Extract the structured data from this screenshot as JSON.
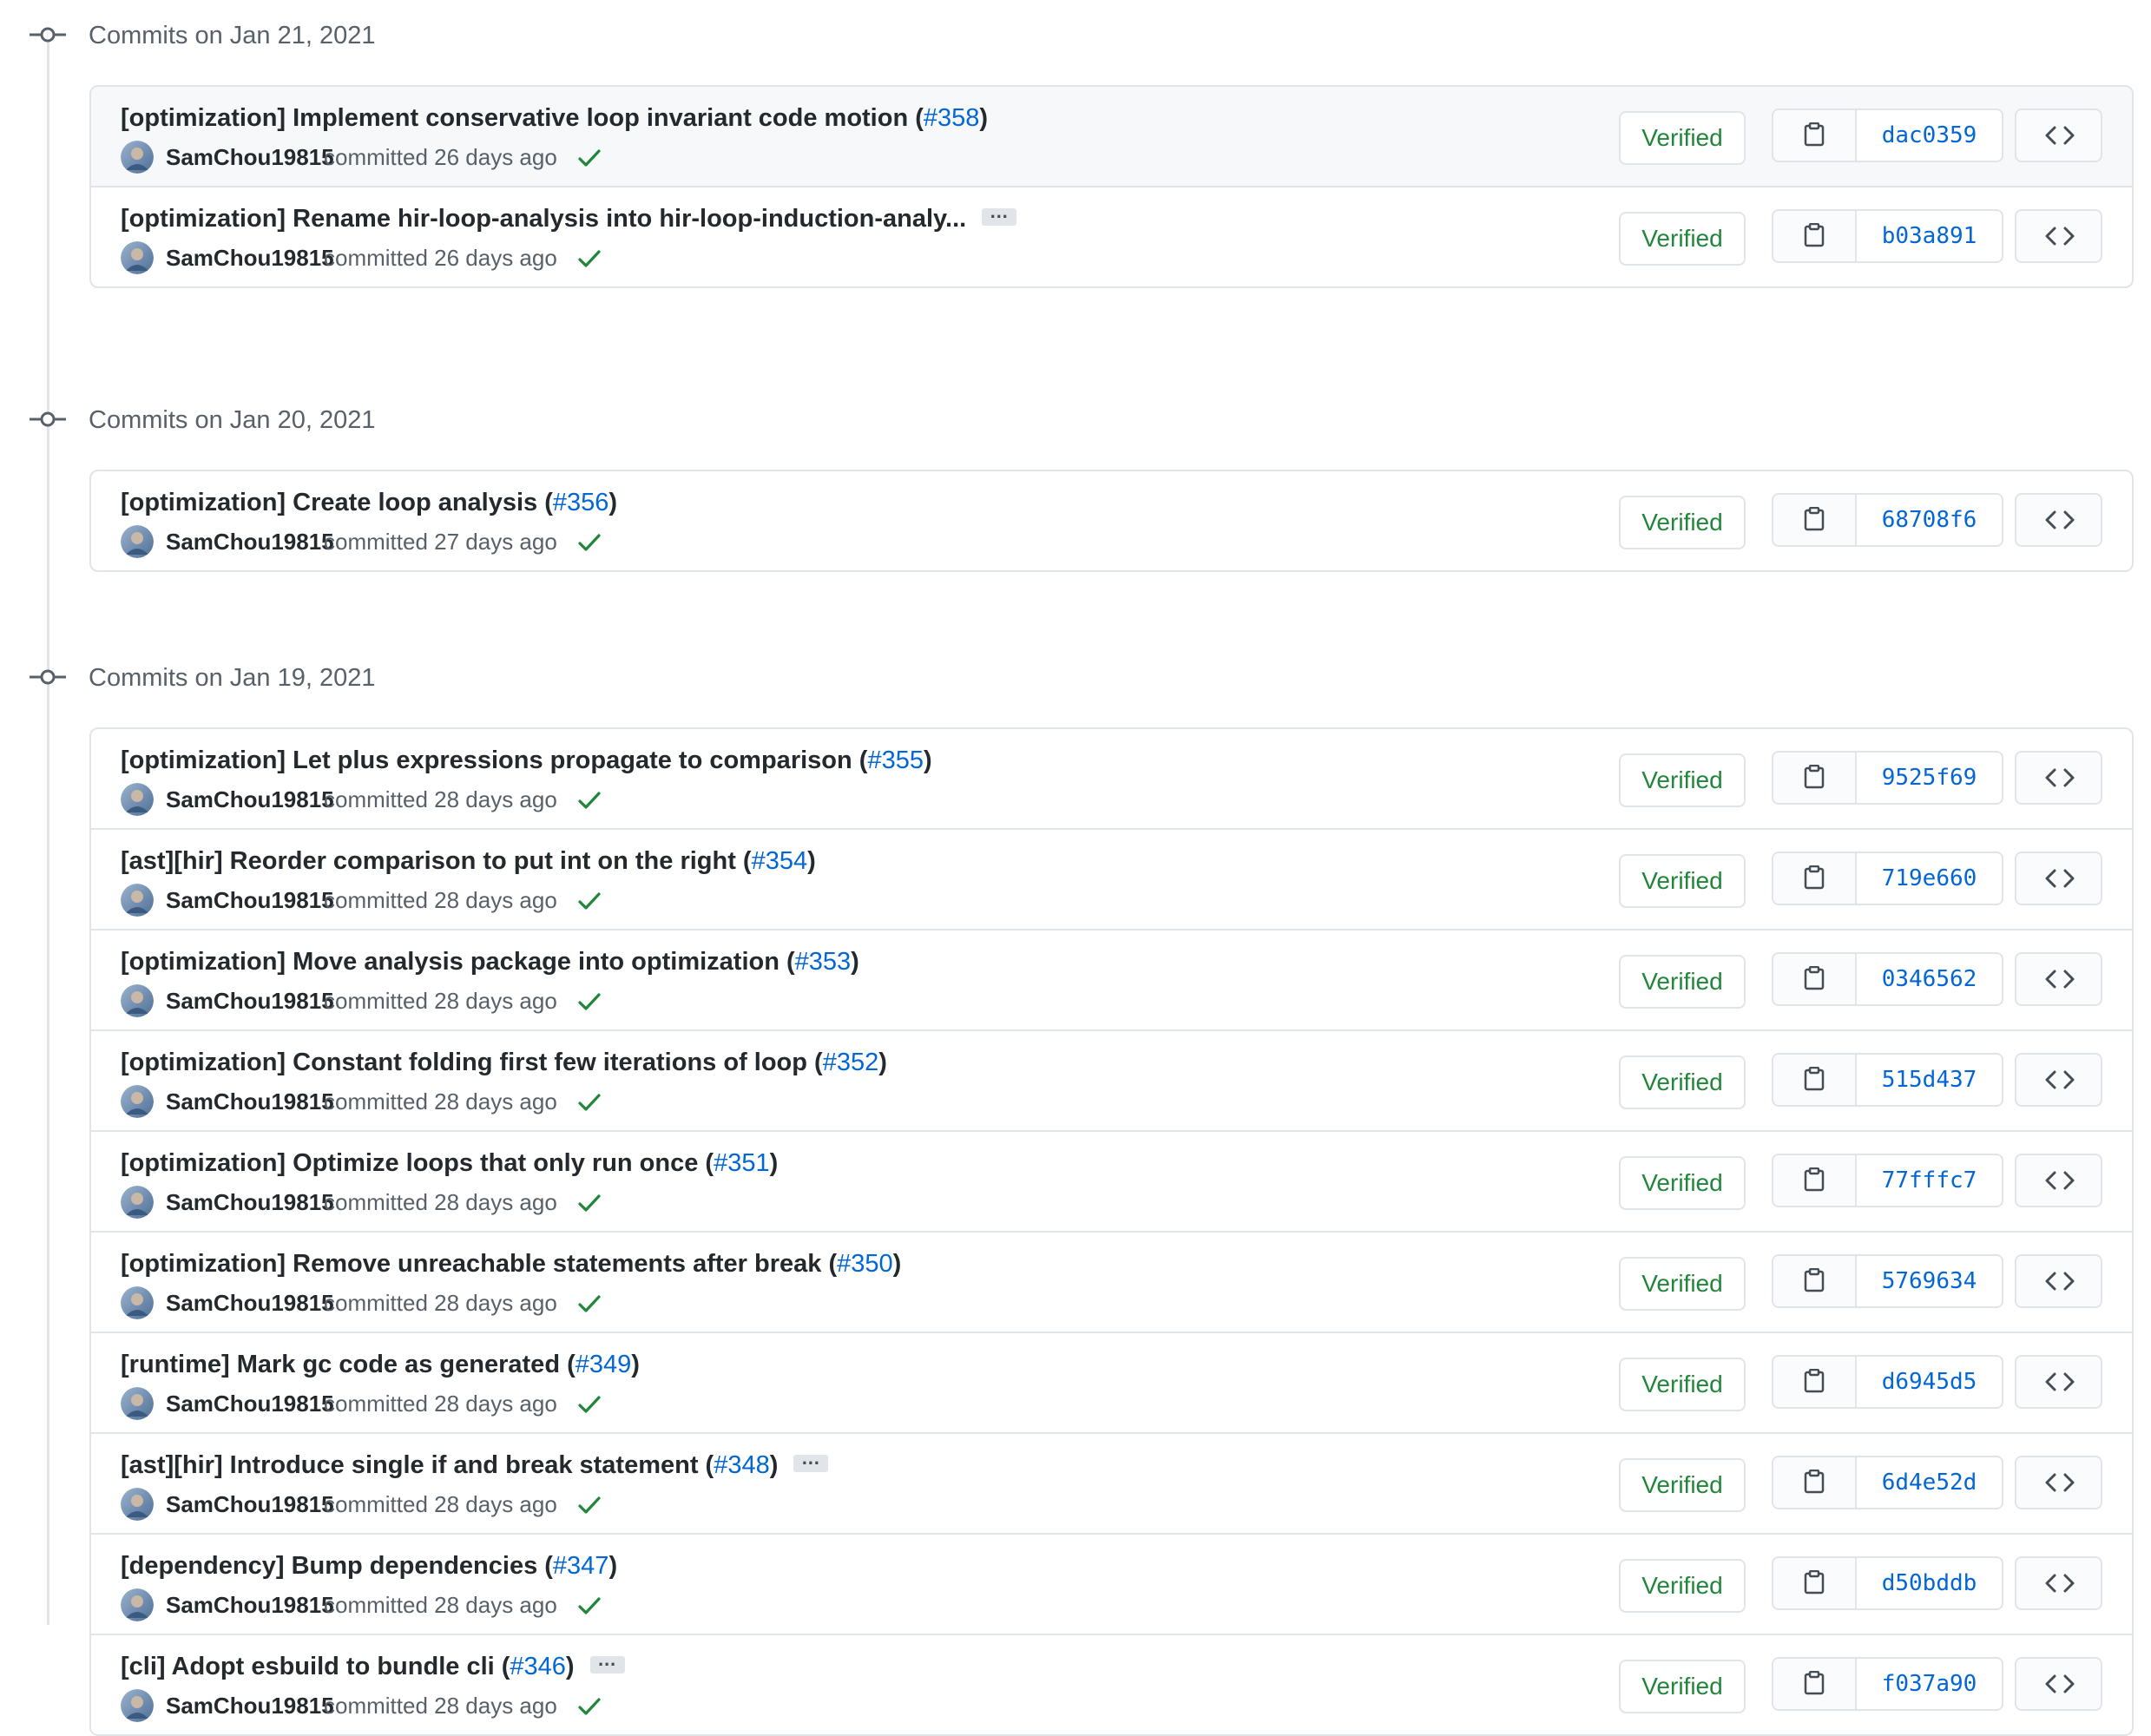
{
  "colors": {
    "link": "#0366d6",
    "verified": "#22863a",
    "border": "#e1e4e8",
    "muted": "#586069"
  },
  "groups": [
    {
      "title": "Commits on Jan 21, 2021",
      "commits": [
        {
          "title": "[optimization] Implement conservative loop invariant code motion",
          "pr": "#358",
          "author": "SamChou19815",
          "meta": "committed 26 days ago",
          "verified": "Verified",
          "sha": "dac0359",
          "ellipsis": false,
          "truncated": false
        },
        {
          "title": "[optimization] Rename hir-loop-analysis into hir-loop-induction-analy...",
          "pr": "",
          "author": "SamChou19815",
          "meta": "committed 26 days ago",
          "verified": "Verified",
          "sha": "b03a891",
          "ellipsis": true,
          "truncated": true
        }
      ]
    },
    {
      "title": "Commits on Jan 20, 2021",
      "commits": [
        {
          "title": "[optimization] Create loop analysis",
          "pr": "#356",
          "author": "SamChou19815",
          "meta": "committed 27 days ago",
          "verified": "Verified",
          "sha": "68708f6",
          "ellipsis": false,
          "truncated": false
        }
      ]
    },
    {
      "title": "Commits on Jan 19, 2021",
      "commits": [
        {
          "title": "[optimization] Let plus expressions propagate to comparison",
          "pr": "#355",
          "author": "SamChou19815",
          "meta": "committed 28 days ago",
          "verified": "Verified",
          "sha": "9525f69",
          "ellipsis": false,
          "truncated": false
        },
        {
          "title": "[ast][hir] Reorder comparison to put int on the right",
          "pr": "#354",
          "author": "SamChou19815",
          "meta": "committed 28 days ago",
          "verified": "Verified",
          "sha": "719e660",
          "ellipsis": false,
          "truncated": false
        },
        {
          "title": "[optimization] Move analysis package into optimization",
          "pr": "#353",
          "author": "SamChou19815",
          "meta": "committed 28 days ago",
          "verified": "Verified",
          "sha": "0346562",
          "ellipsis": false,
          "truncated": false
        },
        {
          "title": "[optimization] Constant folding first few iterations of loop",
          "pr": "#352",
          "author": "SamChou19815",
          "meta": "committed 28 days ago",
          "verified": "Verified",
          "sha": "515d437",
          "ellipsis": false,
          "truncated": false
        },
        {
          "title": "[optimization] Optimize loops that only run once",
          "pr": "#351",
          "author": "SamChou19815",
          "meta": "committed 28 days ago",
          "verified": "Verified",
          "sha": "77fffc7",
          "ellipsis": false,
          "truncated": false
        },
        {
          "title": "[optimization] Remove unreachable statements after break",
          "pr": "#350",
          "author": "SamChou19815",
          "meta": "committed 28 days ago",
          "verified": "Verified",
          "sha": "5769634",
          "ellipsis": false,
          "truncated": false
        },
        {
          "title": "[runtime] Mark gc code as generated",
          "pr": "#349",
          "author": "SamChou19815",
          "meta": "committed 28 days ago",
          "verified": "Verified",
          "sha": "d6945d5",
          "ellipsis": false,
          "truncated": false
        },
        {
          "title": "[ast][hir] Introduce single if and break statement",
          "pr": "#348",
          "author": "SamChou19815",
          "meta": "committed 28 days ago",
          "verified": "Verified",
          "sha": "6d4e52d",
          "ellipsis": true,
          "truncated": false
        },
        {
          "title": "[dependency] Bump dependencies",
          "pr": "#347",
          "author": "SamChou19815",
          "meta": "committed 28 days ago",
          "verified": "Verified",
          "sha": "d50bddb",
          "ellipsis": false,
          "truncated": false
        },
        {
          "title": "[cli] Adopt esbuild to bundle cli",
          "pr": "#346",
          "author": "SamChou19815",
          "meta": "committed 28 days ago",
          "verified": "Verified",
          "sha": "f037a90",
          "ellipsis": true,
          "truncated": false
        }
      ]
    }
  ],
  "icons": {
    "timeline": "git-commit-icon",
    "status": "check-icon",
    "copy": "clipboard-icon",
    "browse": "code-icon",
    "more": "ellipsis-icon"
  }
}
